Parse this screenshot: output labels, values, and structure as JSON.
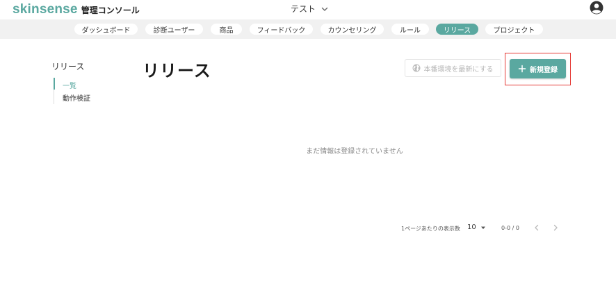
{
  "header": {
    "brand": "skinsense",
    "console_label": "管理コンソール",
    "environment": "テスト"
  },
  "nav": {
    "tabs": [
      {
        "label": "ダッシュボード",
        "active": false
      },
      {
        "label": "診断ユーザー",
        "active": false
      },
      {
        "label": "商品",
        "active": false
      },
      {
        "label": "フィードバック",
        "active": false
      },
      {
        "label": "カウンセリング",
        "active": false
      },
      {
        "label": "ルール",
        "active": false
      },
      {
        "label": "リリース",
        "active": true
      },
      {
        "label": "プロジェクト",
        "active": false
      }
    ]
  },
  "sidebar": {
    "title": "リリース",
    "items": [
      {
        "label": "一覧",
        "active": true
      },
      {
        "label": "動作検証",
        "active": false
      }
    ]
  },
  "main": {
    "title": "リリース",
    "update_prod_label": "本番環境を最新にする",
    "new_label": "新規登録",
    "empty_message": "まだ情報は登録されていません"
  },
  "pagination": {
    "rows_label": "1ページあたりの表示数",
    "rows_per_page": "10",
    "range": "0-0 / 0"
  },
  "colors": {
    "accent": "#5aa8a0",
    "highlight": "#e53935"
  }
}
